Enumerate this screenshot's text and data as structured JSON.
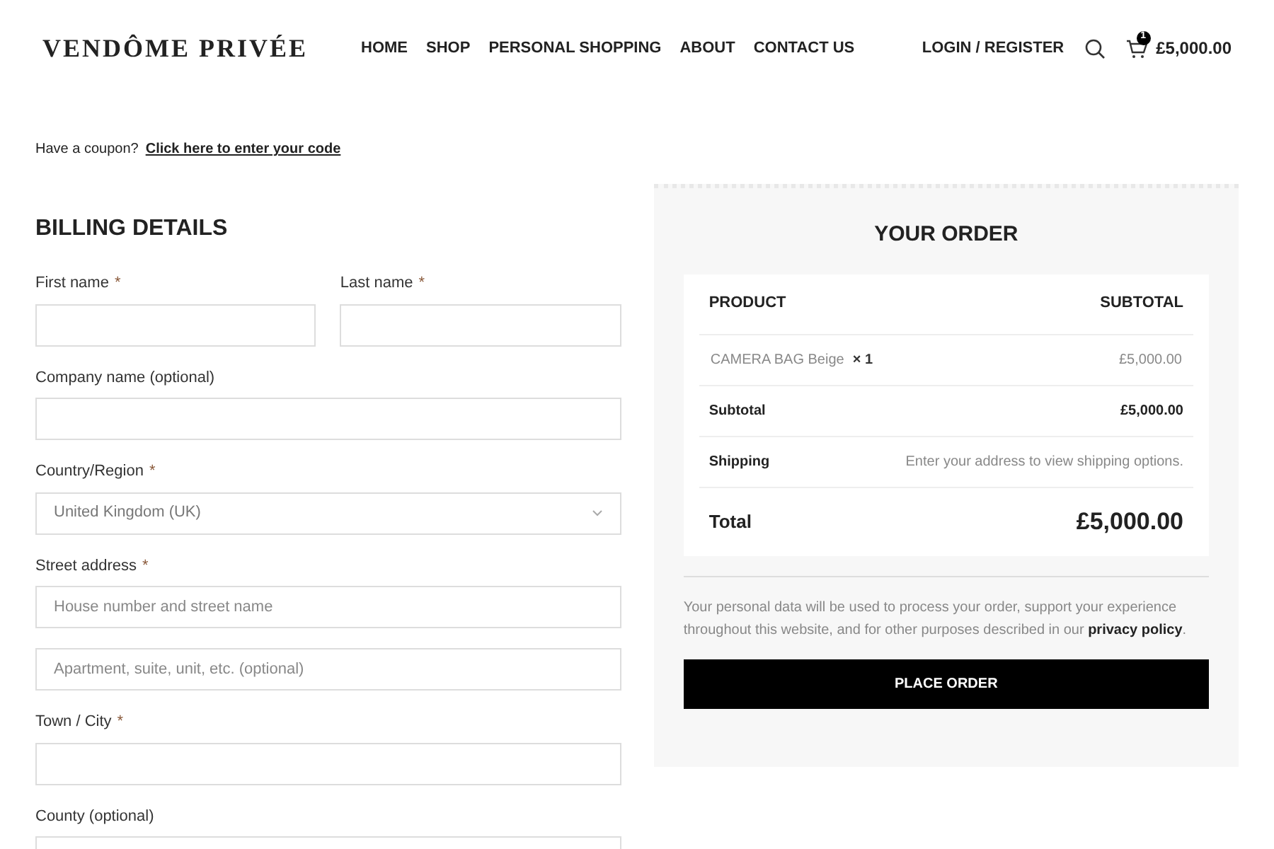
{
  "header": {
    "logo": "VENDÔME PRIVÉE",
    "nav": [
      {
        "label": "HOME"
      },
      {
        "label": "SHOP"
      },
      {
        "label": "PERSONAL SHOPPING"
      },
      {
        "label": "ABOUT"
      },
      {
        "label": "CONTACT US"
      }
    ],
    "account": "LOGIN / REGISTER",
    "cart_count": "1",
    "cart_total": "£5,000.00"
  },
  "coupon": {
    "text": "Have a coupon?",
    "link": "Click here to enter your code"
  },
  "billing": {
    "title": "BILLING DETAILS",
    "rows": [
      [
        {
          "kind": "text",
          "label": "First name",
          "required_mark": "*"
        },
        {
          "kind": "text",
          "label": "Last name",
          "required_mark": "*"
        }
      ],
      [
        {
          "kind": "text",
          "label": "Company name (optional)"
        }
      ],
      [
        {
          "kind": "select",
          "label": "Country/Region",
          "required_mark": "*",
          "value": "United Kingdom (UK)"
        }
      ],
      [
        {
          "kind": "text",
          "label": "Street address",
          "required_mark": "*",
          "placeholder": "House number and street name"
        }
      ],
      [
        {
          "kind": "text",
          "placeholder": "Apartment, suite, unit, etc. (optional)"
        }
      ],
      [
        {
          "kind": "text",
          "label": "Town / City",
          "required_mark": "*"
        }
      ],
      [
        {
          "kind": "text",
          "label": "County (optional)"
        }
      ]
    ]
  },
  "order": {
    "title": "YOUR ORDER",
    "columns": [
      "PRODUCT",
      "SUBTOTAL"
    ],
    "item": {
      "name": "CAMERA BAG Beige",
      "qty": "× 1",
      "price": "£5,000.00"
    },
    "subtotal": {
      "label": "Subtotal",
      "value": "£5,000.00"
    },
    "shipping": {
      "label": "Shipping",
      "value": "Enter your address to view shipping options."
    },
    "total": {
      "label": "Total",
      "value": "£5,000.00"
    },
    "privacy_text": "Your personal data will be used to process your order, support your experience throughout this website, and for other purposes described in our",
    "privacy_link": "privacy policy",
    "privacy_end": ".",
    "button": "PLACE ORDER"
  }
}
